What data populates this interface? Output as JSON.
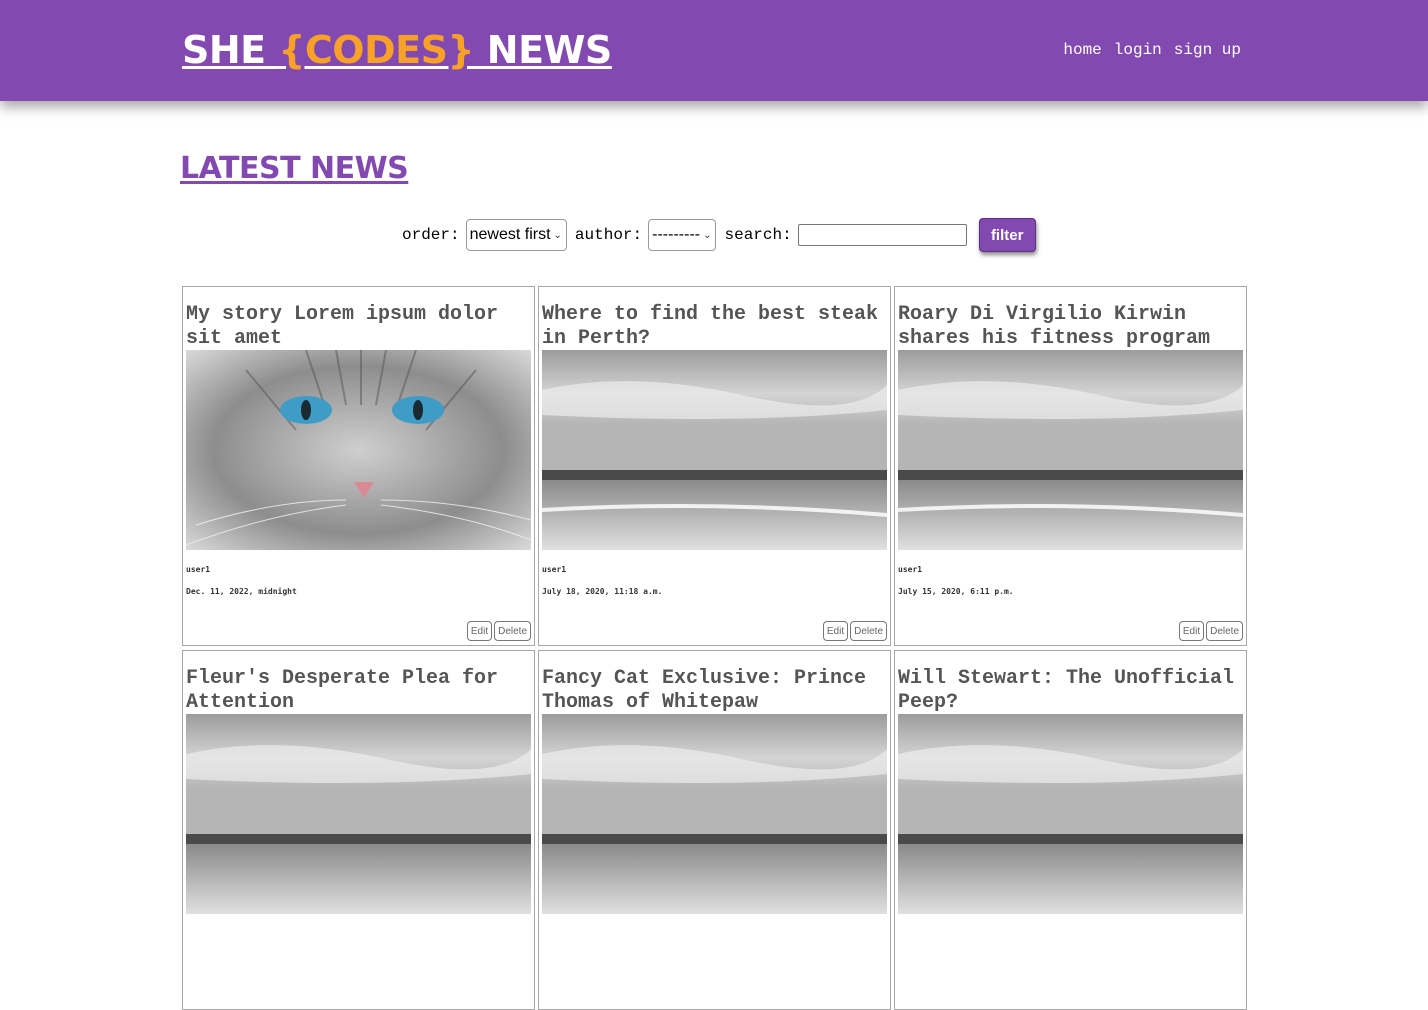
{
  "header": {
    "logo_pre": "SHE ",
    "logo_codes": "{CODES}",
    "logo_post": " NEWS",
    "nav": [
      "home",
      "login",
      "sign up"
    ]
  },
  "main": {
    "title": "LATEST NEWS",
    "filters": {
      "order_label": "order:",
      "order_value": "newest first",
      "author_label": "author:",
      "author_value": "---------",
      "search_label": "search:",
      "search_value": "",
      "filter_button": "filter"
    },
    "stories": [
      {
        "title": "My story Lorem ipsum dolor sit amet",
        "author": "user1",
        "date": "Dec. 11, 2022, midnight",
        "image": "cat-photo",
        "edit": "Edit",
        "delete": "Delete"
      },
      {
        "title": "Where to find the best steak in Perth?",
        "author": "user1",
        "date": "July 18, 2020, 11:18 a.m.",
        "image": "beach-photo",
        "edit": "Edit",
        "delete": "Delete"
      },
      {
        "title": "Roary Di Virgilio Kirwin shares his fitness program",
        "author": "user1",
        "date": "July 15, 2020, 6:11 p.m.",
        "image": "beach-photo",
        "edit": "Edit",
        "delete": "Delete"
      },
      {
        "title": "Fleur's Desperate Plea for Attention",
        "image": "beach-photo"
      },
      {
        "title": "Fancy Cat Exclusive: Prince Thomas of Whitepaw",
        "image": "beach-photo"
      },
      {
        "title": "Will Stewart: The Unofficial Peep?",
        "image": "beach-photo"
      }
    ]
  },
  "colors": {
    "brand_purple": "#8249b0",
    "accent_orange": "#f7a128"
  }
}
